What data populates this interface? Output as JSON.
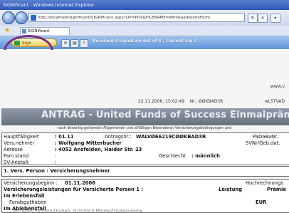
{
  "window": {
    "title": "SIGNificant - Windows Internet Explorer"
  },
  "address_bar": {
    "url": "http://localhost/significant/SIGNificant.aspx?OP=POS&FILENAME=WinStaaddscheForm"
  },
  "tabs": [
    {
      "label": "SIGNificant"
    }
  ],
  "toolbar": {
    "sign_label": "Sign",
    "status": "Received 0 signature out of 4 , Current Sig 1"
  },
  "document": {
    "header_right": "www.v",
    "date_line": "22.11.2006, 15:02:49",
    "nr_label": "Nr.:",
    "nr_value": "ØØKBAD3R",
    "code_right": "wLSTVAD",
    "banner": "ANTRAG - United Funds of Success Einmalprämie",
    "subheading": "nach derzeitig geltenden Allgemeinen und allfälligen Besonderen Versicherungsbedingungen und",
    "fields": [
      {
        "label": "Hauptfälligkeit",
        "value": ": 01.11",
        "mid_label": "Antragsnr.:",
        "mid_value": "WALVØ66219CØØKBAD3R",
        "right": "PaDaBaNr."
      },
      {
        "label": "Vers.nehmer",
        "value": ": Wolfgang Mitterbucher",
        "right": "SVNr/Geb.dat."
      },
      {
        "label": "Adresse",
        "value": ": 4052 Ansfelden, Haider Str. 23"
      },
      {
        "label": "Fam.stand",
        "value": ":",
        "mid_label": "Geschlecht",
        "mid_value": ": männlich"
      },
      {
        "label": "SV-Anstalt",
        "value": ":"
      }
    ],
    "section1": "1. Vers. Person : Versicherungsnehmer",
    "insurance_start_label": "Versicherungsbeginn :",
    "insurance_start_value": "01.11.2006",
    "insurance_right": "Hochrechnungs",
    "benefits_heading": "Versicherungsleistungen für Versicherte Person 1 :",
    "col_leistung": "Leistung",
    "col_praemie": "Prämie",
    "erleben": "Im Erlebensfall",
    "fondsguthaben": "Fondsguthaben",
    "currency": "EUR",
    "ableben": "Im Ablebensfall",
    "ableben_detail": "aktuelles Fondsguthaben, zuzüglich Mindestrisikosumme"
  }
}
